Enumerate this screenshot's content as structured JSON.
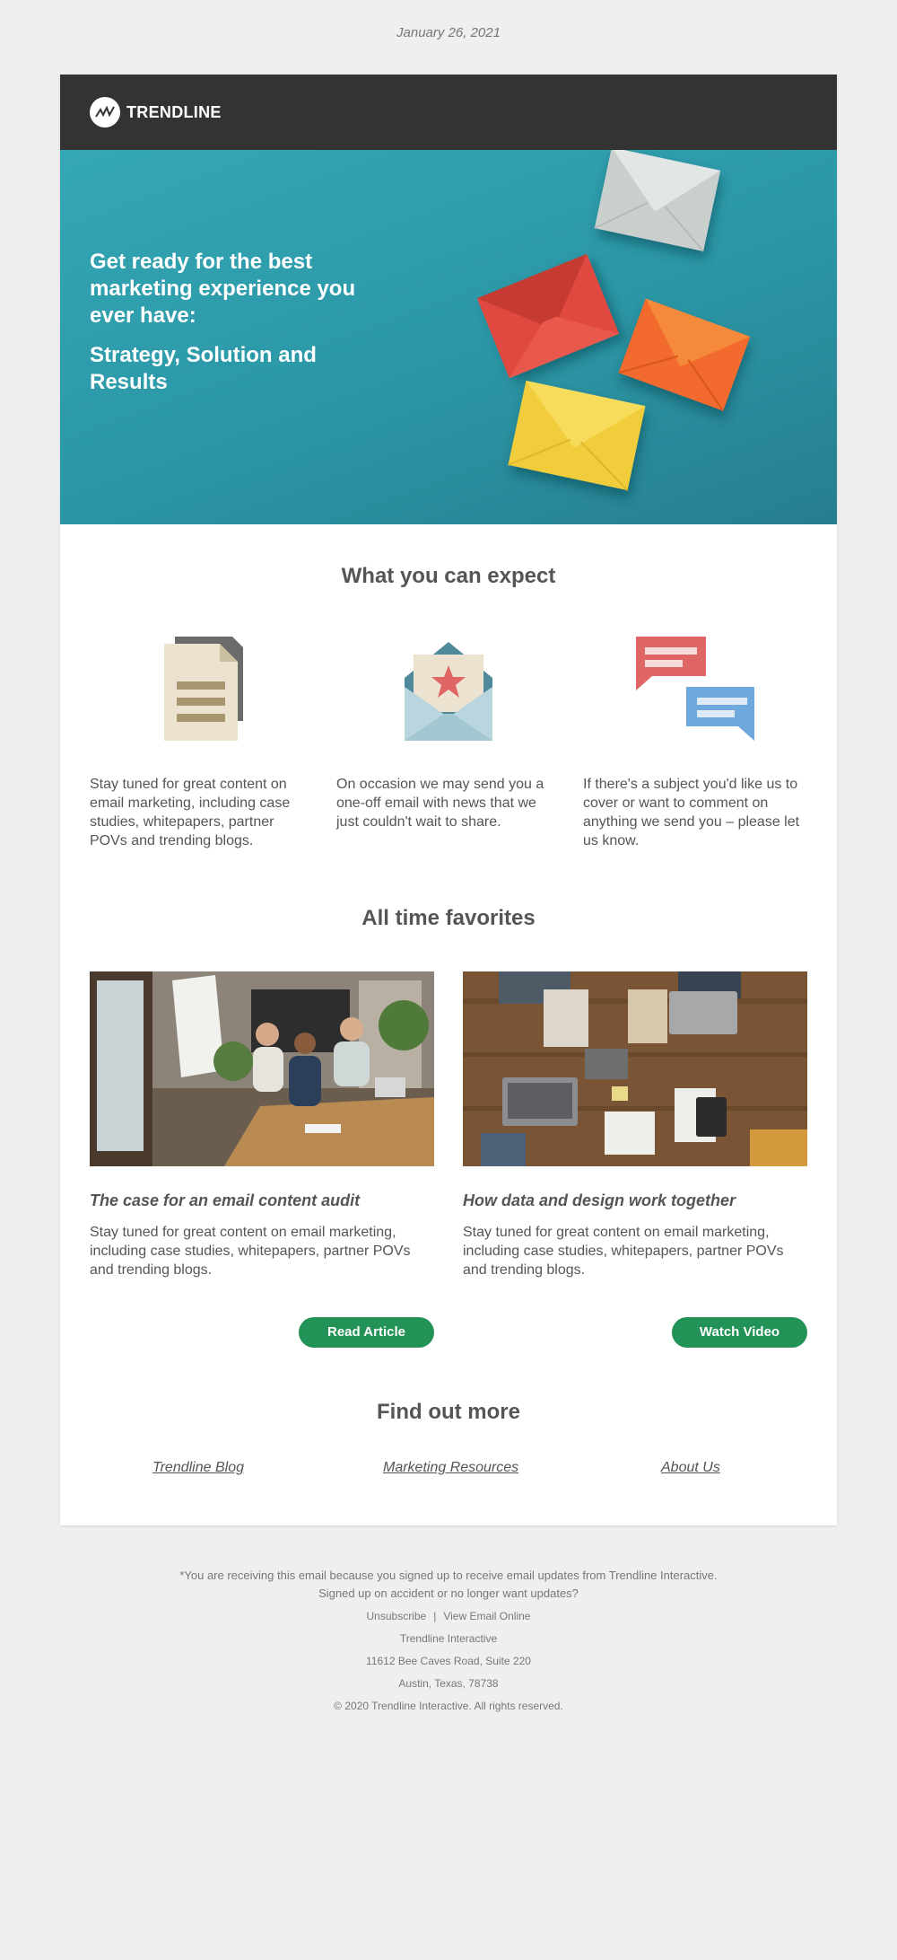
{
  "date": "January 26, 2021",
  "brand": {
    "name": "TRENDLINE"
  },
  "hero": {
    "headline": "Get ready for the best marketing experience you ever have:",
    "subheadline": "Strategy, Solution and Results"
  },
  "expect": {
    "title": "What you can expect",
    "items": [
      {
        "icon": "document-icon",
        "text": "Stay tuned for great content on email marketing, including case studies, whitepapers, partner POVs and trending blogs."
      },
      {
        "icon": "envelope-star-icon",
        "text": "On occasion we may send you a one-off email with news that we just couldn't wait to share."
      },
      {
        "icon": "chat-bubbles-icon",
        "text": "If there's a subject you'd like us to cover or want to comment on anything we send you – please let us know."
      }
    ]
  },
  "favorites": {
    "title": "All time favorites",
    "articles": [
      {
        "title": "The case for an email content audit",
        "text": "Stay tuned for great content on email marketing, including case studies, whitepapers, partner POVs and trending blogs.",
        "button": "Read Article"
      },
      {
        "title": "How data and design work together",
        "text": "Stay tuned for great content on email marketing, including case studies, whitepapers, partner POVs and trending blogs.",
        "button": "Watch Video"
      }
    ]
  },
  "more": {
    "title": "Find out more",
    "links": [
      "Trendline Blog",
      "Marketing Resources",
      "About Us"
    ]
  },
  "footer": {
    "notice": "*You are receiving this email because you signed up to receive email updates from Trendline Interactive.",
    "notice2": "Signed up on accident or no longer want updates?",
    "unsubscribe": "Unsubscribe",
    "separator": "|",
    "view_online": "View Email Online",
    "company": "Trendline Interactive",
    "address1": "11612 Bee Caves Road, Suite 220",
    "address2": "Austin, Texas, 78738",
    "copyright": "© 2020 Trendline Interactive. All rights reserved."
  },
  "colors": {
    "topbar": "#333333",
    "hero": "#2b96a5",
    "button": "#229257",
    "background": "#efefef"
  }
}
